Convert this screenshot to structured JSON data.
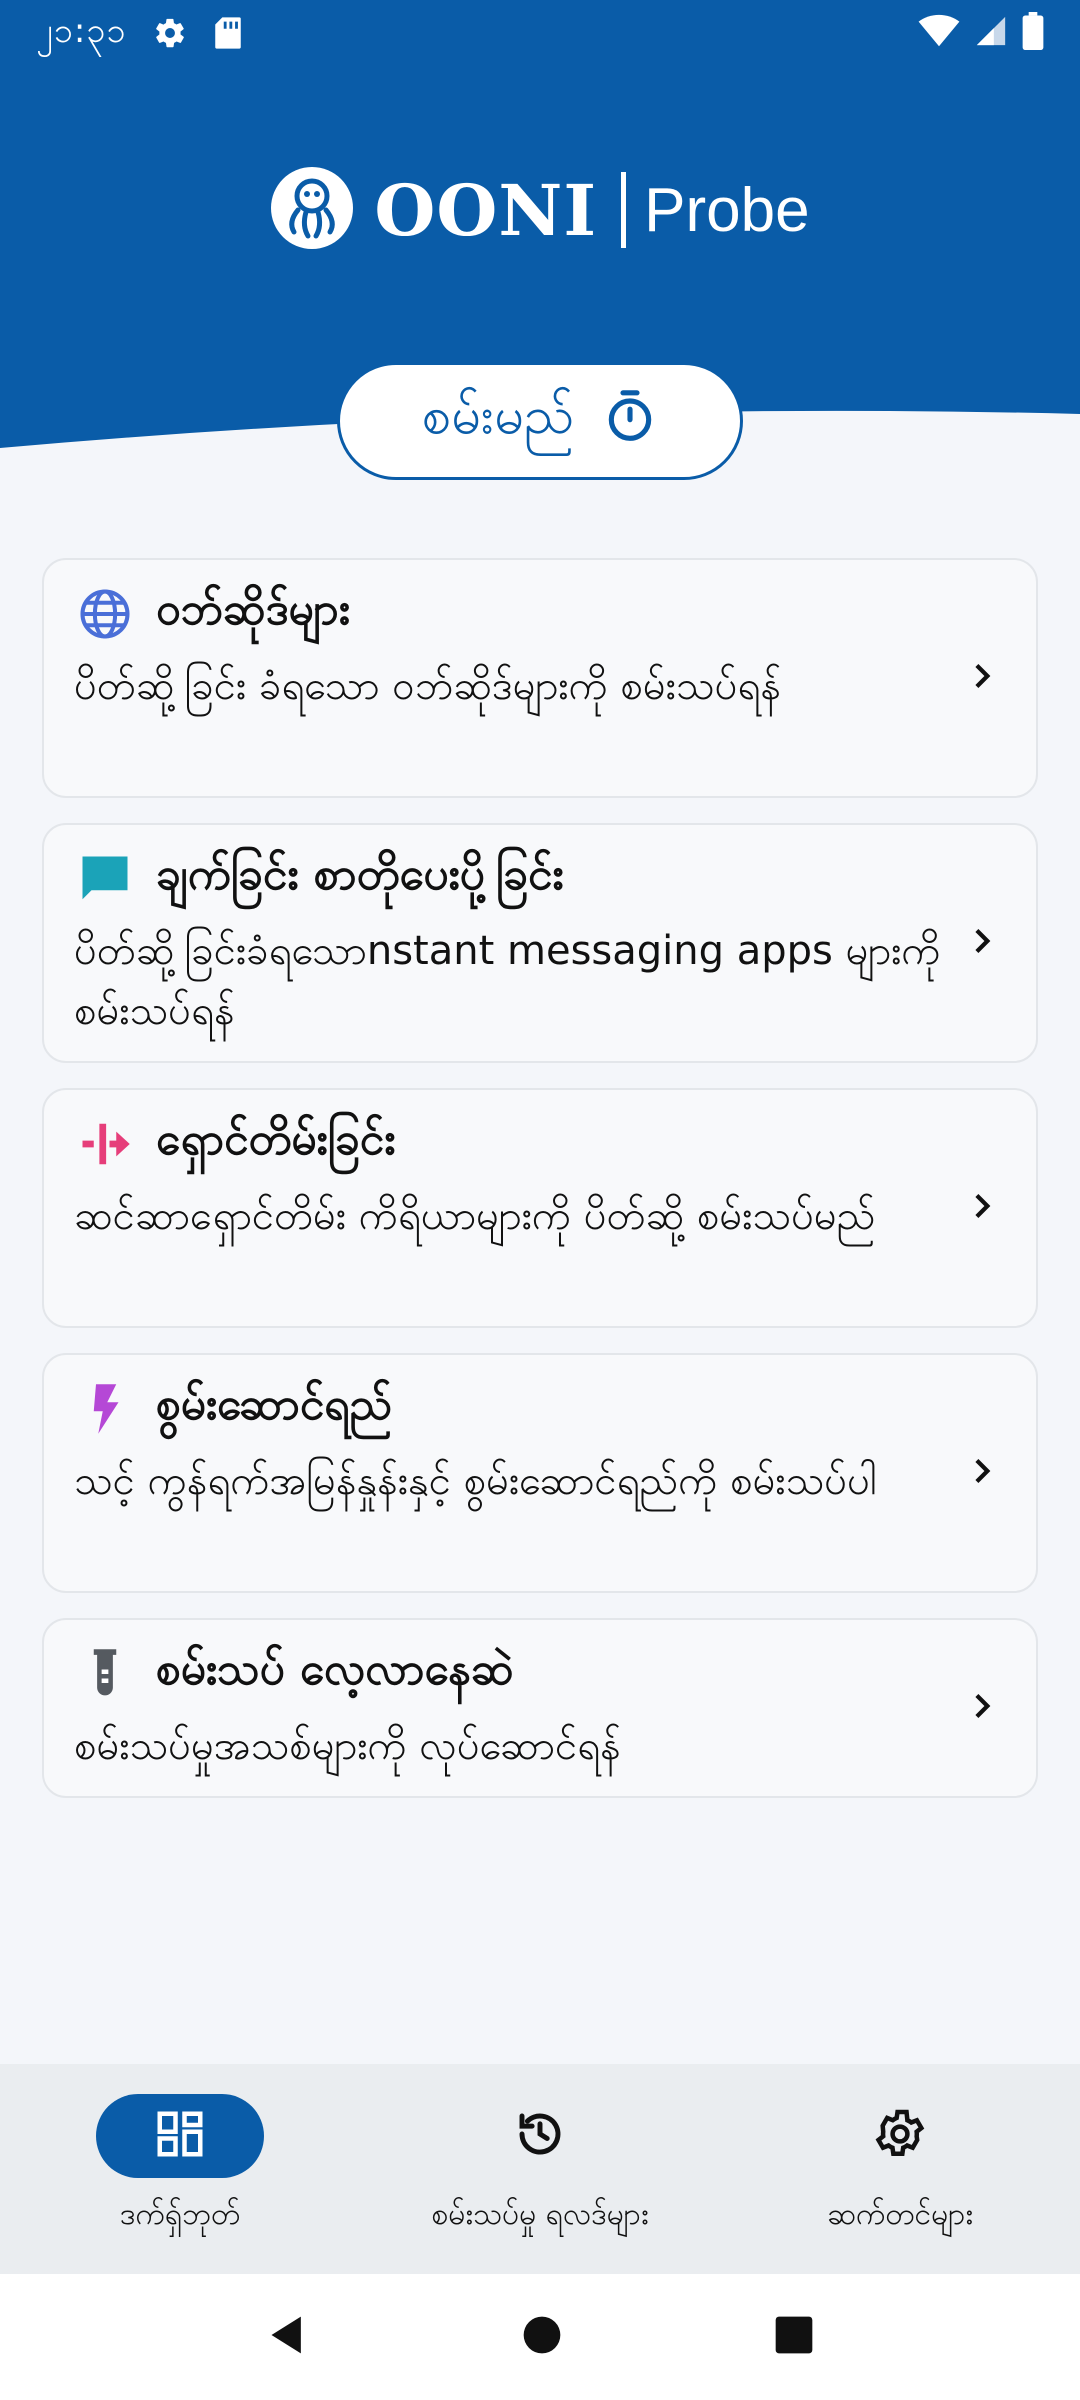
{
  "status": {
    "time": "၂၁:၃၁",
    "icons": [
      "gear-icon",
      "sd-card-icon",
      "wifi-icon",
      "signal-icon",
      "battery-icon"
    ]
  },
  "header": {
    "brand": "OONI",
    "product": "Probe",
    "run_label": "စမ်းမည်",
    "color": "#0a5ca8"
  },
  "cards": [
    {
      "title": "ဝဘ်ဆိုဒ်များ",
      "desc": "ပိတ်ဆို့ခြင်း ခံရသော ဝဘ်ဆိုဒ်များကို စမ်းသပ်ရန်",
      "icon": "globe-icon",
      "color": "#4a6fd8"
    },
    {
      "title": "ချက်ခြင်း စာတိုပေးပို့ခြင်း",
      "desc": "ပိတ်ဆို့ခြင်းခံရသောnstant messaging apps များကို စမ်းသပ်ရန်",
      "icon": "chat-bubble-icon",
      "color": "#1ba3b8"
    },
    {
      "title": "ရှောင်တိမ်းခြင်း",
      "desc": "ဆင်ဆာရှောင်တိမ်း ကိရိယာများကို ပိတ်ဆို့ စမ်းသပ်မည်",
      "icon": "circumvention-icon",
      "color": "#e63e7a"
    },
    {
      "title": "စွမ်းဆောင်ရည်",
      "desc": "သင့် ကွန်ရက်အမြန်နှုန်းနှင့် စွမ်းဆောင်ရည်ကို စမ်းသပ်ပါ",
      "icon": "lightning-icon",
      "color": "#b548d6"
    },
    {
      "title": "စမ်းသပ် လေ့လာနေဆဲ",
      "desc": "စမ်းသပ်မှုအသစ်များကို လုပ်ဆောင်ရန်",
      "icon": "test-tube-icon",
      "color": "#555a60"
    }
  ],
  "nav": [
    {
      "label": "ဒက်ရှ်ဘုတ်",
      "icon": "dashboard-icon",
      "active": true
    },
    {
      "label": "စမ်းသပ်မှု ရလဒ်များ",
      "icon": "history-icon",
      "active": false
    },
    {
      "label": "ဆက်တင်များ",
      "icon": "settings-gear-icon",
      "active": false
    }
  ]
}
